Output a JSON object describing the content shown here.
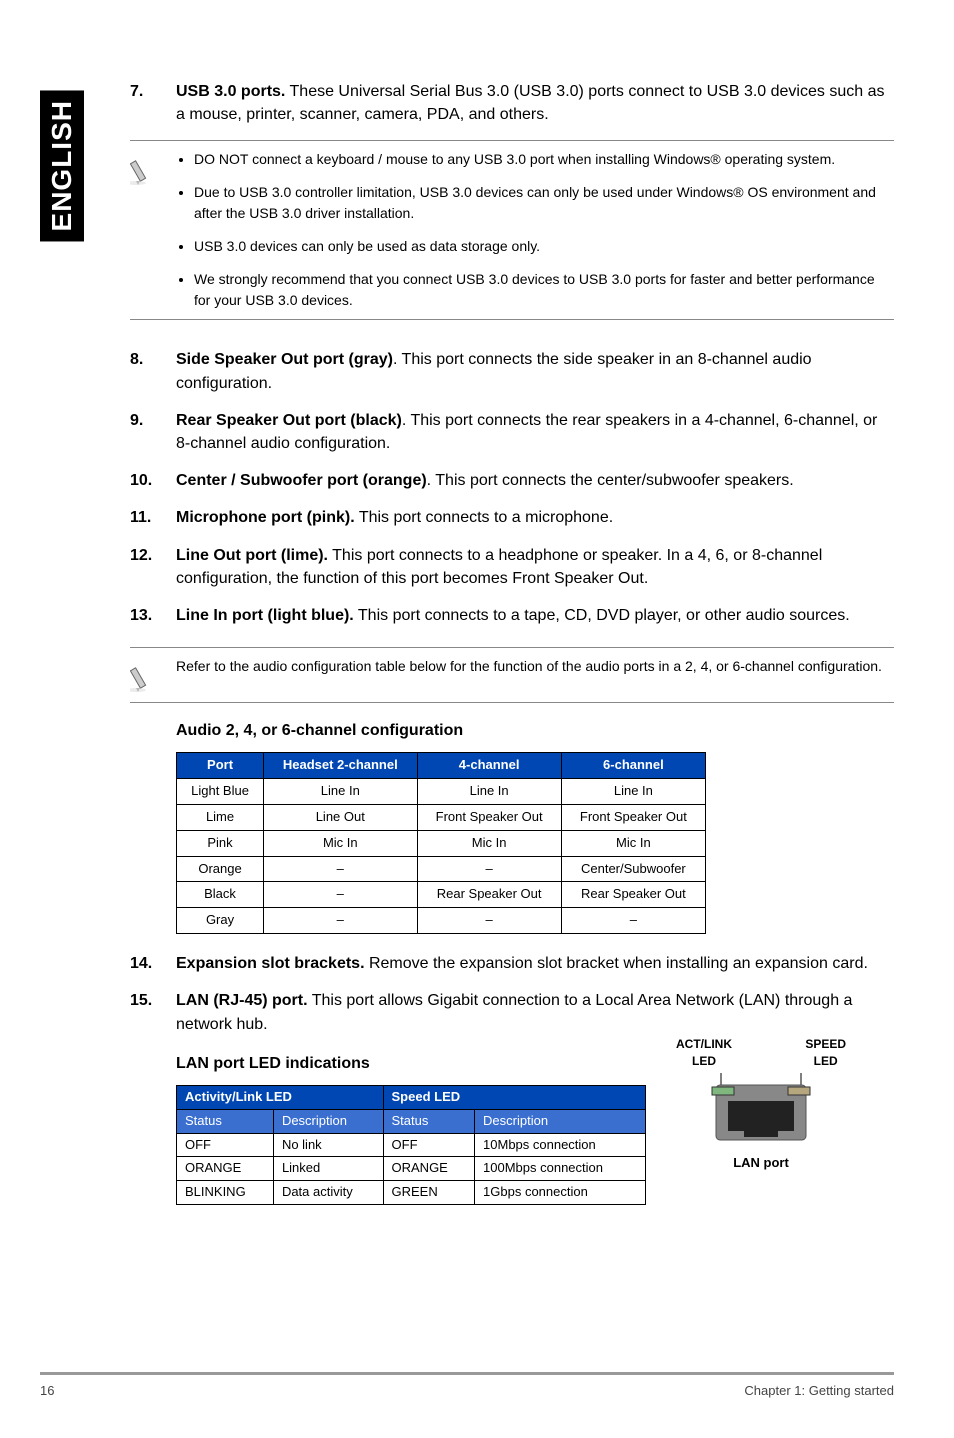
{
  "side_tab": "ENGLISH",
  "items": {
    "7": {
      "title": "USB 3.0 ports.",
      "text": " These Universal Serial Bus 3.0 (USB 3.0) ports connect to USB 3.0 devices such as a mouse, printer, scanner, camera, PDA, and others.",
      "notes": [
        "DO NOT connect a keyboard / mouse to any USB 3.0 port when installing Windows® operating system.",
        "Due to USB 3.0 controller limitation, USB 3.0 devices can only be used under Windows® OS environment and after the USB 3.0 driver installation.",
        "USB 3.0 devices can only be used as data storage only.",
        "We strongly recommend that you connect USB 3.0 devices to USB 3.0 ports for faster and better performance for your USB 3.0 devices."
      ]
    },
    "8": {
      "title": "Side Speaker Out port (gray)",
      "text": ". This port connects the side speaker in an 8-channel audio configuration."
    },
    "9": {
      "title": "Rear Speaker Out port (black)",
      "text": ". This port connects the rear speakers in a 4-channel, 6-channel, or 8-channel audio configuration."
    },
    "10": {
      "title": "Center / Subwoofer port (orange)",
      "text": ". This port connects the center/subwoofer speakers."
    },
    "11": {
      "title": "Microphone port (pink).",
      "text": " This port connects to a microphone."
    },
    "12": {
      "title": "Line Out port (lime).",
      "text": " This port connects to a headphone or speaker. In a 4, 6, or 8-channel configuration, the function of this port becomes Front Speaker Out."
    },
    "13": {
      "title": "Line In port (light blue).",
      "text": " This port connects to a tape, CD, DVD player, or other audio sources.",
      "note_single": "Refer to the audio configuration table below for the function of the audio ports in a 2, 4, or 6-channel configuration."
    },
    "14": {
      "title": "Expansion slot brackets.",
      "text": " Remove the expansion slot bracket when installing an expansion card."
    },
    "15": {
      "title": "LAN (RJ-45) port.",
      "text": " This port allows Gigabit connection to a Local Area Network (LAN) through a network hub."
    }
  },
  "audio_heading": "Audio 2, 4, or 6-channel configuration",
  "audio_table": {
    "headers": [
      "Port",
      "Headset 2-channel",
      "4-channel",
      "6-channel"
    ],
    "rows": [
      [
        "Light Blue",
        "Line In",
        "Line In",
        "Line In"
      ],
      [
        "Lime",
        "Line Out",
        "Front Speaker Out",
        "Front Speaker Out"
      ],
      [
        "Pink",
        "Mic In",
        "Mic In",
        "Mic In"
      ],
      [
        "Orange",
        "–",
        "–",
        "Center/Subwoofer"
      ],
      [
        "Black",
        "–",
        "Rear Speaker Out",
        "Rear Speaker Out"
      ],
      [
        "Gray",
        "–",
        "–",
        "–"
      ]
    ]
  },
  "lan_heading": "LAN port LED indications",
  "lan_table": {
    "group_headers": [
      "Activity/Link LED",
      "Speed LED"
    ],
    "sub_headers": [
      "Status",
      "Description",
      "Status",
      "Description"
    ],
    "rows": [
      [
        "OFF",
        "No link",
        "OFF",
        "10Mbps connection"
      ],
      [
        "ORANGE",
        "Linked",
        "ORANGE",
        "100Mbps connection"
      ],
      [
        "BLINKING",
        "Data activity",
        "GREEN",
        "1Gbps connection"
      ]
    ]
  },
  "lan_diagram": {
    "left_label_1": "ACT/LINK",
    "left_label_2": "LED",
    "right_label_1": "SPEED",
    "right_label_2": "LED",
    "caption": "LAN port"
  },
  "footer": {
    "page": "16",
    "chapter": "Chapter 1: Getting started"
  }
}
